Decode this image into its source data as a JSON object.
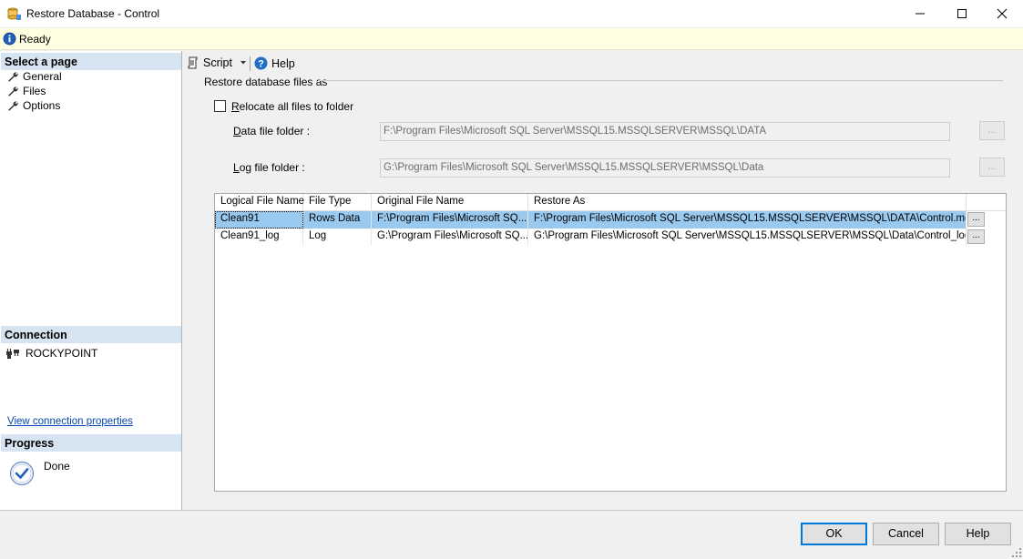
{
  "window": {
    "title": "Restore Database - Control"
  },
  "status": {
    "text": "Ready"
  },
  "left": {
    "select_page_header": "Select a page",
    "pages": [
      {
        "label": "General"
      },
      {
        "label": "Files"
      },
      {
        "label": "Options"
      }
    ],
    "connection_header": "Connection",
    "server": "ROCKYPOINT",
    "view_connection_link": "View connection properties",
    "progress_header": "Progress",
    "progress_status": "Done"
  },
  "toolbar": {
    "script_label": "Script",
    "help_label": "Help"
  },
  "main": {
    "group_title": "Restore database files as",
    "relocate_label": "Relocate all files to folder",
    "relocate_checked": false,
    "data_folder_label": "Data file folder :",
    "data_folder_value": "F:\\Program Files\\Microsoft SQL Server\\MSSQL15.MSSQLSERVER\\MSSQL\\DATA",
    "log_folder_label": "Log file folder :",
    "log_folder_value": "G:\\Program Files\\Microsoft SQL Server\\MSSQL15.MSSQLSERVER\\MSSQL\\Data",
    "browse_label": "..."
  },
  "grid": {
    "columns": [
      "Logical File Name",
      "File Type",
      "Original File Name",
      "Restore As"
    ],
    "rows": [
      {
        "logical": "Clean91",
        "type": "Rows Data",
        "original": "F:\\Program Files\\Microsoft SQ...",
        "restore_as": "F:\\Program Files\\Microsoft SQL Server\\MSSQL15.MSSQLSERVER\\MSSQL\\DATA\\Control.mdf",
        "button": "...",
        "selected": true
      },
      {
        "logical": "Clean91_log",
        "type": "Log",
        "original": "G:\\Program Files\\Microsoft SQ...",
        "restore_as": "G:\\Program Files\\Microsoft SQL Server\\MSSQL15.MSSQLSERVER\\MSSQL\\Data\\Control_log.ldf",
        "button": "...",
        "selected": false
      }
    ]
  },
  "buttons": {
    "ok": "OK",
    "cancel": "Cancel",
    "help": "Help"
  },
  "colors": {
    "status_bg": "#ffffe1",
    "section_header_bg": "#d6e3f0",
    "selected_row": "#99c9ef",
    "primary_border": "#0078d7",
    "link": "#0645ad"
  }
}
